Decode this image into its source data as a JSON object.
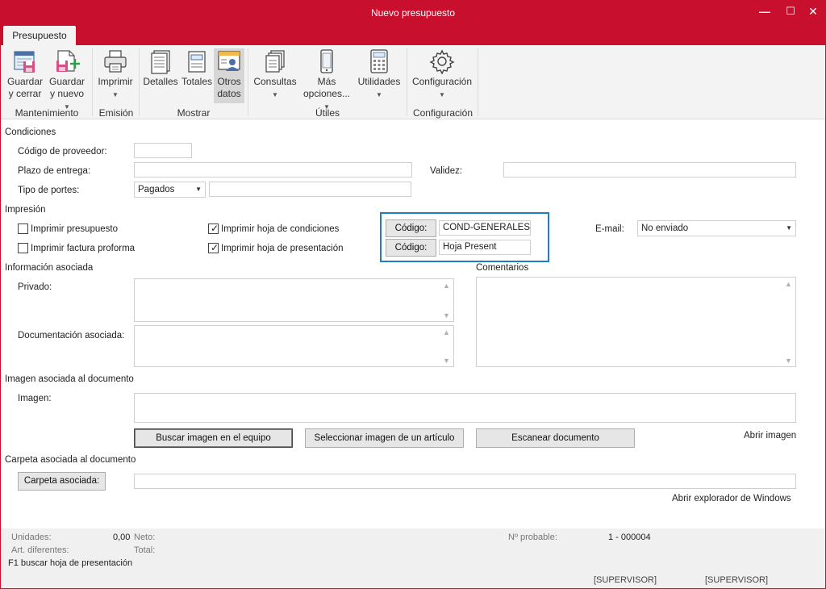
{
  "window": {
    "title": "Nuevo presupuesto",
    "minimize_glyph": "—",
    "maximize_glyph": "☐",
    "close_glyph": "✕"
  },
  "ribbon": {
    "tab": "Presupuesto",
    "buttons": {
      "guardar_cerrar": [
        "Guardar",
        "y cerrar"
      ],
      "guardar_nuevo": [
        "Guardar",
        "y nuevo"
      ],
      "imprimir": "Imprimir",
      "detalles": "Detalles",
      "totales": "Totales",
      "otros_datos": [
        "Otros",
        "datos"
      ],
      "consultas": "Consultas",
      "mas_opciones": [
        "Más",
        "opciones..."
      ],
      "utilidades": "Utilidades",
      "configuracion": "Configuración"
    },
    "groups": {
      "mantenimiento": "Mantenimiento",
      "emision": "Emisión",
      "mostrar": "Mostrar",
      "utiles": "Útiles",
      "configuracion": "Configuración"
    }
  },
  "condiciones": {
    "section": "Condiciones",
    "codigo_proveedor_label": "Código de proveedor:",
    "codigo_proveedor_value": "",
    "plazo_entrega_label": "Plazo de entrega:",
    "plazo_entrega_value": "",
    "validez_label": "Validez:",
    "validez_value": "",
    "tipo_portes_label": "Tipo de portes:",
    "tipo_portes_value": "Pagados",
    "tipo_portes_extra": ""
  },
  "impresion": {
    "section": "Impresión",
    "imprimir_presupuesto": {
      "label": "Imprimir presupuesto",
      "checked": false
    },
    "imprimir_factura_proforma": {
      "label": "Imprimir factura proforma",
      "checked": false
    },
    "imprimir_hoja_condiciones": {
      "label": "Imprimir hoja de condiciones",
      "checked": true
    },
    "imprimir_hoja_presentacion": {
      "label": "Imprimir hoja de presentación",
      "checked": true
    },
    "codigo_condiciones_label": "Código:",
    "codigo_condiciones_value": "COND-GENERALES",
    "codigo_presentacion_label": "Código:",
    "codigo_presentacion_value": "Hoja Present",
    "email_label": "E-mail:",
    "email_value": "No enviado",
    "check_glyph": "✓"
  },
  "informacion": {
    "section": "Información asociada",
    "privado_label": "Privado:",
    "documentacion_label": "Documentación asociada:",
    "comentarios_label": "Comentarios"
  },
  "imagen": {
    "section": "Imagen asociada al documento",
    "imagen_label": "Imagen:",
    "buscar_button": "Buscar imagen en el equipo",
    "seleccionar_button": "Seleccionar imagen de un artículo",
    "escanear_button": "Escanear documento",
    "abrir_imagen": "Abrir imagen"
  },
  "carpeta": {
    "section": "Carpeta asociada al documento",
    "carpeta_button": "Carpeta asociada:",
    "carpeta_value": "",
    "abrir_explorador": "Abrir explorador de Windows"
  },
  "footer": {
    "unidades_label": "Unidades:",
    "unidades_value": "0,00",
    "art_diferentes_label": "Art. diferentes:",
    "neto_label": "Neto:",
    "total_label": "Total:",
    "n_probable_label": "Nº probable:",
    "n_probable_value": "1 - 000004",
    "hint": "F1 buscar hoja de presentación",
    "user1": "[SUPERVISOR]",
    "user2": "[SUPERVISOR]"
  },
  "colors": {
    "accent": "#c8102e",
    "highlight_box": "#1f7dc4"
  }
}
